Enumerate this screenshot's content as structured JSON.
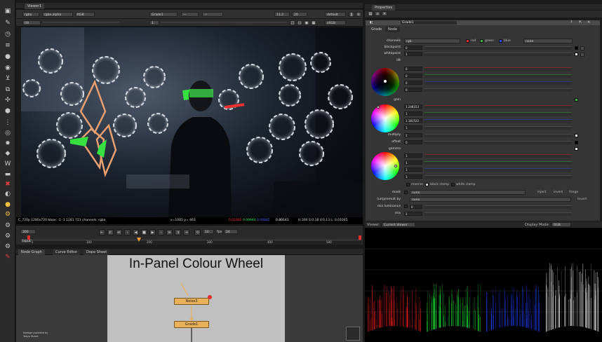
{
  "viewer": {
    "tab_label": "Viewer1",
    "channels_dropdown": "rgba",
    "alpha_dropdown": "rgba.alpha",
    "colorspace_dropdown": "RGB",
    "a_input": "Grade1",
    "zoom": "11.2",
    "proxy": "20",
    "lut": "default",
    "gain_value": "f/8",
    "gamma_value": "1",
    "view_dropdown": "sRGB",
    "status_text": "C_720p 1280x720 bbox: -1 -1 1281 721 channels: rgba",
    "cursor_text": "x=1005 y= 463",
    "sample_r": "0.01092",
    "sample_g": "0.00944",
    "sample_b": "0.00845",
    "sample_a": "0.80141",
    "hsv_text": "H:300 S:0.18 V:0.13  L: 0.01045"
  },
  "timeline": {
    "frame": "300",
    "fps_label": "fps",
    "fps_value": "24",
    "playback_increment": "10",
    "range_dropdown": "Input",
    "tick_labels": [
      "1",
      "100",
      "200",
      "300",
      "400",
      "500"
    ]
  },
  "node_graph": {
    "tabs": [
      "Node Graph",
      "Curve Editor",
      "Dope Sheet"
    ],
    "title": "In-Panel Colour Wheel",
    "nodes": [
      "Noise3",
      "Grade1"
    ],
    "credit_line_1": "footage provided by ",
    "credit_line_2": "Tokyo Street"
  },
  "properties": {
    "title": "Properties",
    "node_name": "Grade1",
    "tabs": [
      "Grade",
      "Node"
    ],
    "channels_label": "channels",
    "channels_value": "rgb",
    "channel_checks": [
      "red",
      "green",
      "blue",
      "none"
    ],
    "blackpoint_label": "blackpoint",
    "blackpoint_value": "0",
    "whitepoint_label": "whitepoint",
    "whitepoint_value": "1",
    "lift_label": "lift",
    "lift_values": [
      "0",
      "0",
      "0",
      "0"
    ],
    "gain_label": "gain",
    "gain_values": [
      "1.248313",
      "1",
      "1.181522",
      "1"
    ],
    "multiply_label": "multiply",
    "multiply_value": "1",
    "offset_label": "offset",
    "offset_value": "0",
    "gamma_label": "gamma",
    "gamma_values": [
      "1",
      "1",
      "1",
      "1"
    ],
    "clamp_checks": [
      "reverse",
      "black clamp",
      "white clamp"
    ],
    "mask_label": "mask",
    "mask_value": "none",
    "inject_label": "inject",
    "invert_label": "invert",
    "fringe_label": "fringe",
    "unpremult_label": "(un)premult by",
    "unpremult_value": "none",
    "invert2_label": "invert",
    "mix_luminance_label": "mix luminance",
    "mix_luminance_value": "0",
    "mix_label": "mix",
    "mix_value": "1"
  },
  "scope": {
    "viewer_label": "Viewer:",
    "viewer_value": "Current Viewer",
    "display_mode_label": "Display Mode:",
    "display_mode_value": "RGB",
    "channel_colors": [
      "#ff2020",
      "#20ff40",
      "#2040ff",
      "#ffffff"
    ]
  },
  "colors": {
    "node_orange": "#e9b25a",
    "panel_bg": "#353535",
    "accent_red": "#ff3030"
  }
}
